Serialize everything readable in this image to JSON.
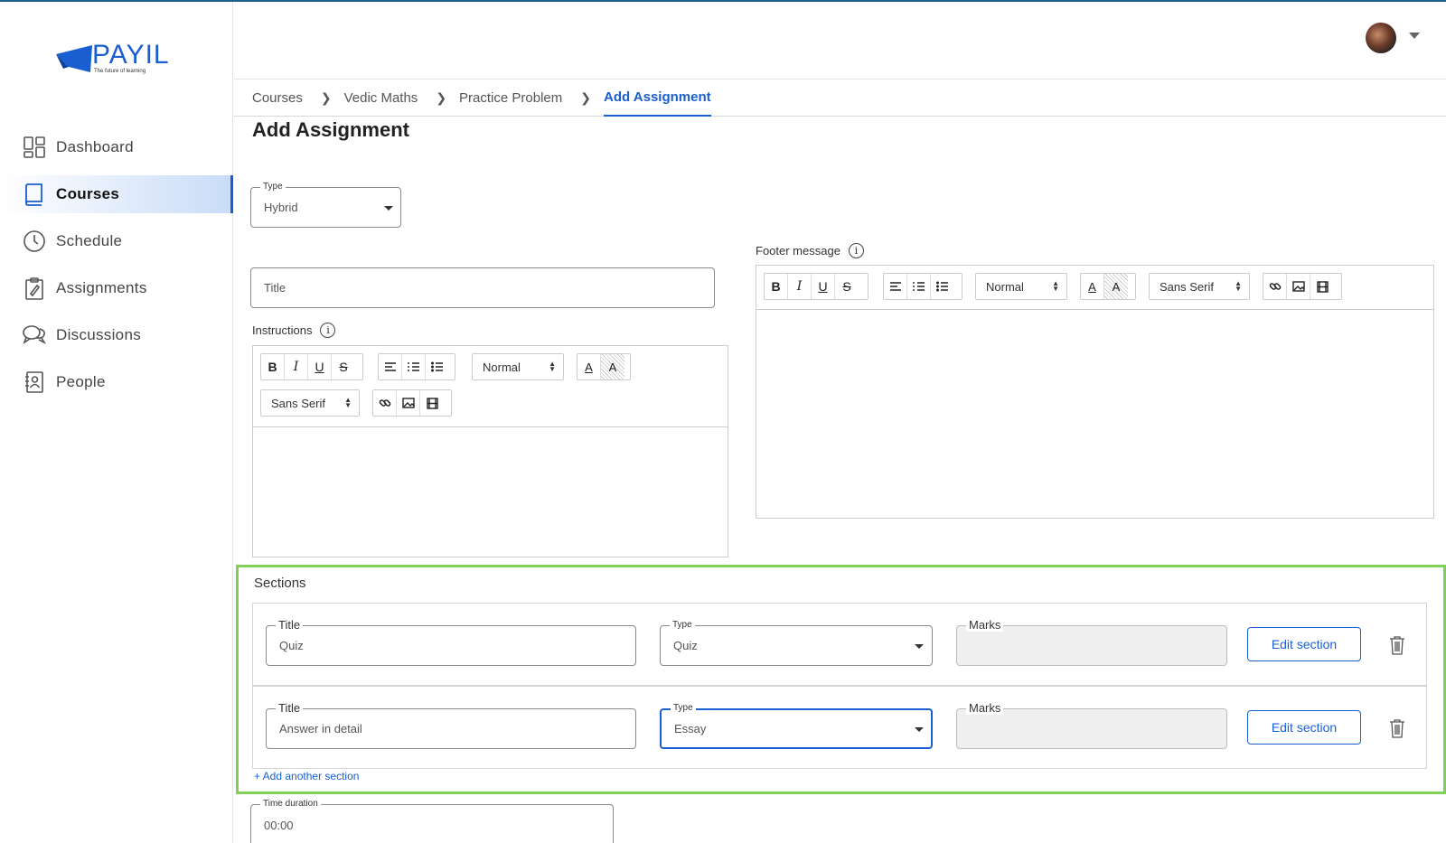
{
  "brand": {
    "name": "PAYIL",
    "tagline": "The future of learning"
  },
  "sidebar": {
    "items": [
      {
        "label": "Dashboard",
        "icon": "dashboard-icon",
        "active": false
      },
      {
        "label": "Courses",
        "icon": "book-icon",
        "active": true
      },
      {
        "label": "Schedule",
        "icon": "clock-icon",
        "active": false
      },
      {
        "label": "Assignments",
        "icon": "clipboard-icon",
        "active": false
      },
      {
        "label": "Discussions",
        "icon": "chat-icon",
        "active": false
      },
      {
        "label": "People",
        "icon": "people-icon",
        "active": false
      }
    ]
  },
  "breadcrumb": [
    "Courses",
    "Vedic Maths",
    "Practice Problem",
    "Add Assignment"
  ],
  "page": {
    "title": "Add Assignment"
  },
  "form": {
    "type": {
      "label": "Type",
      "value": "Hybrid"
    },
    "title": {
      "placeholder": "Title"
    },
    "instructions": {
      "label": "Instructions",
      "info": "i"
    },
    "footer": {
      "label": "Footer message",
      "info": "i"
    },
    "editor": {
      "bold": "B",
      "italic": "I",
      "underline": "U",
      "strike": "S",
      "size": "Normal",
      "font": "Sans Serif",
      "color": "A",
      "background": "A"
    },
    "time_duration": {
      "label": "Time duration",
      "value": "00:00"
    }
  },
  "sections": {
    "title": "Sections",
    "rows": [
      {
        "title_label": "Title",
        "title_value": "Quiz",
        "type_label": "Type",
        "type_value": "Quiz",
        "marks_label": "Marks",
        "edit_label": "Edit section"
      },
      {
        "title_label": "Title",
        "title_value": "Answer in detail",
        "type_label": "Type",
        "type_value": "Essay",
        "marks_label": "Marks",
        "edit_label": "Edit section"
      }
    ],
    "add_label": "+ Add another section"
  },
  "colors": {
    "accent": "#1a5fd1",
    "highlight": "#7ed05a"
  }
}
